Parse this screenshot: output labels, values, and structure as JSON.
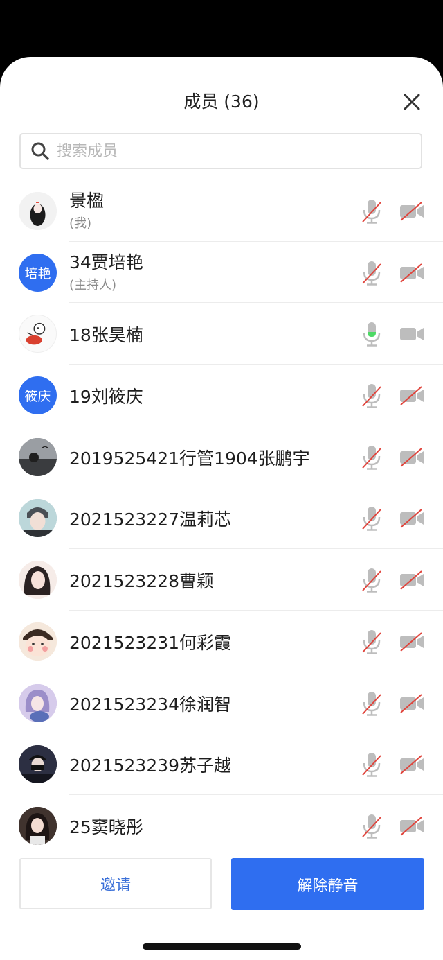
{
  "header": {
    "title": "成员 (36)"
  },
  "search": {
    "placeholder": "搜索成员"
  },
  "members": [
    {
      "name": "景楹",
      "sub": "(我)",
      "avatar": "photo",
      "mic": "muted",
      "cam": "off"
    },
    {
      "name": "34贾培艳",
      "sub": "(主持人)",
      "avatar_text": "培艳",
      "mic": "muted",
      "cam": "off"
    },
    {
      "name": "18张昊楠",
      "sub": "",
      "avatar": "photo",
      "mic": "on",
      "cam": "on"
    },
    {
      "name": "19刘筱庆",
      "sub": "",
      "avatar_text": "筱庆",
      "mic": "muted",
      "cam": "off"
    },
    {
      "name": "2019525421行管1904张鹏宇",
      "sub": "",
      "avatar": "photo",
      "mic": "muted",
      "cam": "off"
    },
    {
      "name": "2021523227温莉芯",
      "sub": "",
      "avatar": "photo",
      "mic": "muted",
      "cam": "off"
    },
    {
      "name": "2021523228曹颖",
      "sub": "",
      "avatar": "photo",
      "mic": "muted",
      "cam": "off"
    },
    {
      "name": "2021523231何彩霞",
      "sub": "",
      "avatar": "photo",
      "mic": "muted",
      "cam": "off"
    },
    {
      "name": "2021523234徐润智",
      "sub": "",
      "avatar": "photo",
      "mic": "muted",
      "cam": "off"
    },
    {
      "name": "2021523239苏子越",
      "sub": "",
      "avatar": "photo",
      "mic": "muted",
      "cam": "off"
    },
    {
      "name": "25窦晓彤",
      "sub": "",
      "avatar": "photo",
      "mic": "muted",
      "cam": "off"
    }
  ],
  "footer": {
    "invite_label": "邀请",
    "unmute_label": "解除静音"
  },
  "colors": {
    "accent": "#2f6ef0",
    "muted_slash": "#e0443c",
    "mic_active": "#4cd964"
  }
}
